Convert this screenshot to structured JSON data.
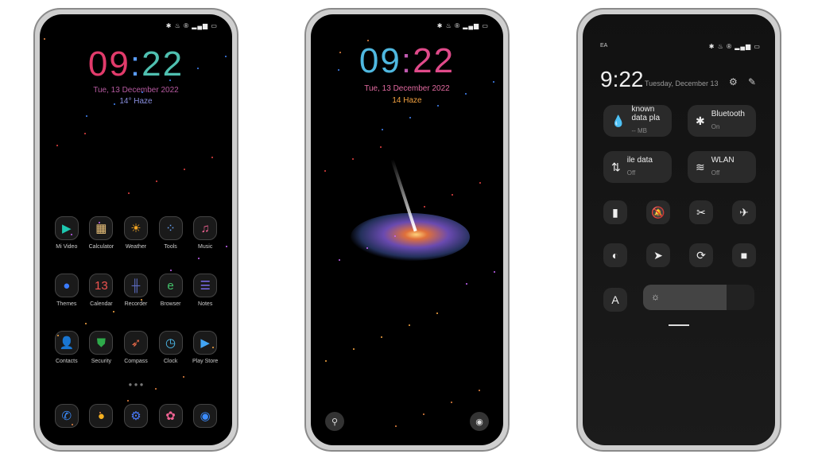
{
  "home": {
    "status": "✱ ♨ ® ▂▄▆ ▭",
    "time_h": "09",
    "time_m": "22",
    "date": "Tue, 13 December 2022",
    "weather": "14° Haze",
    "apps": [
      {
        "label": "Mi Video",
        "icon": "▶",
        "color": "#1ec8b0"
      },
      {
        "label": "Calculator",
        "icon": "▦",
        "color": "#e8c07a"
      },
      {
        "label": "Weather",
        "icon": "☀",
        "color": "#f5a623"
      },
      {
        "label": "Tools",
        "icon": "⁘",
        "color": "#6aa7ff"
      },
      {
        "label": "Music",
        "icon": "♫",
        "color": "#f06292"
      },
      {
        "label": "Themes",
        "icon": "●",
        "color": "#3a7bff"
      },
      {
        "label": "Calendar",
        "icon": "13",
        "color": "#ef5350"
      },
      {
        "label": "Recorder",
        "icon": "╫",
        "color": "#5c6bc0"
      },
      {
        "label": "Browser",
        "icon": "e",
        "color": "#43c36b"
      },
      {
        "label": "Notes",
        "icon": "☰",
        "color": "#7c6cf0"
      },
      {
        "label": "Contacts",
        "icon": "👤",
        "color": "#4fc3a1"
      },
      {
        "label": "Security",
        "icon": "⛊",
        "color": "#2eaa4a"
      },
      {
        "label": "Compass",
        "icon": "➶",
        "color": "#ef6c4a"
      },
      {
        "label": "Clock",
        "icon": "◷",
        "color": "#4fc3f7"
      },
      {
        "label": "Play Store",
        "icon": "▶",
        "color": "#42a5f5"
      }
    ],
    "dock": [
      {
        "icon": "✆",
        "color": "#3b8cff",
        "name": "phone-icon"
      },
      {
        "icon": "●",
        "color": "#f5b020",
        "name": "messages-icon"
      },
      {
        "icon": "⚙",
        "color": "#4a7cff",
        "name": "settings-icon"
      },
      {
        "icon": "✿",
        "color": "#f06292",
        "name": "gallery-icon"
      },
      {
        "icon": "◉",
        "color": "#3b8cff",
        "name": "camera-icon"
      }
    ],
    "page_dots": "● ● ●"
  },
  "lock": {
    "status": "✱ ♨ ® ▂▄▆ ▭",
    "time_h": "09",
    "time_m": "22",
    "date": "Tue, 13 December 2022",
    "weather": "14 Haze",
    "flashlight_icon": "⚲",
    "camera_icon": "◉"
  },
  "control": {
    "carrier": "EA",
    "status": "✱ ♨ ® ▂▄▆ ▭",
    "time": "9:22",
    "date": "Tuesday, December 13",
    "tiles": [
      {
        "title": "known data pla",
        "sub": "-- MB",
        "icon": "💧"
      },
      {
        "title": "Bluetooth",
        "sub": "On",
        "icon": "✱"
      },
      {
        "title": "ile data",
        "sub": "Off",
        "icon": "⇅"
      },
      {
        "title": "WLAN",
        "sub": "Off",
        "icon": "≋"
      }
    ],
    "toggles": [
      {
        "name": "flashlight-icon",
        "icon": "▮"
      },
      {
        "name": "mute-icon",
        "icon": "🔕"
      },
      {
        "name": "screenshot-icon",
        "icon": "✂"
      },
      {
        "name": "airplane-icon",
        "icon": "✈"
      },
      {
        "name": "dark-mode-icon",
        "icon": "◐"
      },
      {
        "name": "location-icon",
        "icon": "➤"
      },
      {
        "name": "rotation-lock-icon",
        "icon": "⟳"
      },
      {
        "name": "screen-record-icon",
        "icon": "■"
      }
    ],
    "font_button": "A",
    "brightness_icon": "☼",
    "brightness": 0.75
  }
}
